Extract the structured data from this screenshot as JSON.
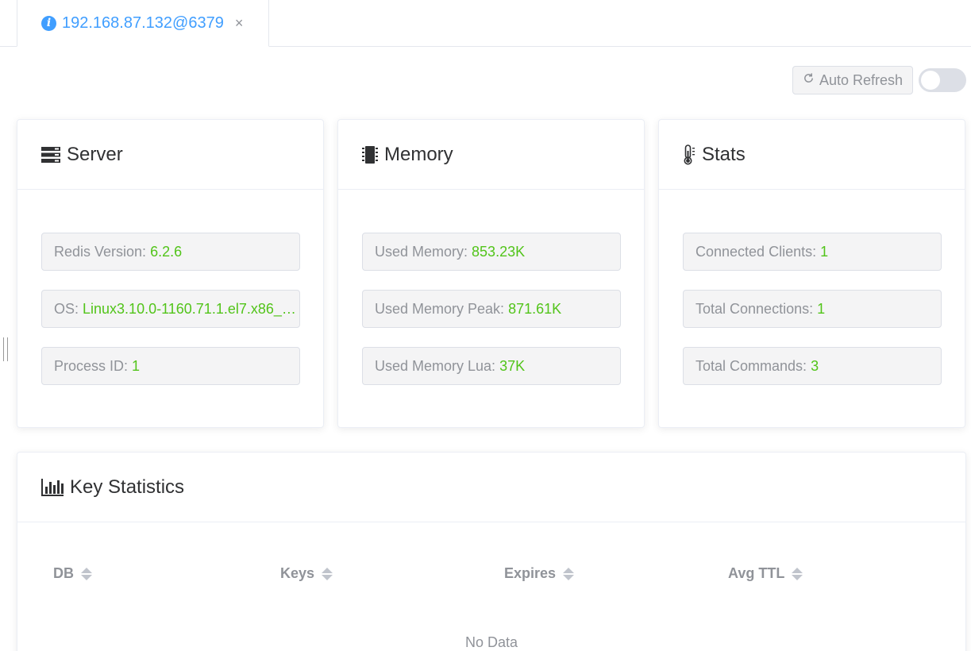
{
  "tab": {
    "title": "192.168.87.132@6379",
    "close": "×"
  },
  "toolbar": {
    "refresh_label": "Auto Refresh",
    "auto_refresh_on": false
  },
  "server": {
    "title": "Server",
    "items": [
      {
        "label": "Redis Version:",
        "value": "6.2.6"
      },
      {
        "label": "OS:",
        "value": "Linux3.10.0-1160.71.1.el7.x86_6..."
      },
      {
        "label": "Process ID:",
        "value": "1"
      }
    ]
  },
  "memory": {
    "title": "Memory",
    "items": [
      {
        "label": "Used Memory:",
        "value": "853.23K"
      },
      {
        "label": "Used Memory Peak:",
        "value": "871.61K"
      },
      {
        "label": "Used Memory Lua:",
        "value": "37K"
      }
    ]
  },
  "stats": {
    "title": "Stats",
    "items": [
      {
        "label": "Connected Clients:",
        "value": "1"
      },
      {
        "label": "Total Connections:",
        "value": "1"
      },
      {
        "label": "Total Commands:",
        "value": "3"
      }
    ]
  },
  "keys": {
    "title": "Key Statistics",
    "columns": [
      "DB",
      "Keys",
      "Expires",
      "Avg TTL"
    ],
    "empty_text": "No Data"
  },
  "colors": {
    "accent": "#409eff",
    "value": "#52c41a",
    "muted": "#909399"
  }
}
